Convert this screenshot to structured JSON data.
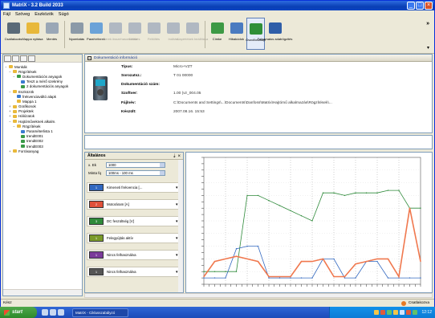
{
  "window": {
    "title": "MatriX - 3.2 Build 2033"
  },
  "menu": {
    "items": [
      "Fájl",
      "Szöveg",
      "Eszközök",
      "Súgó"
    ]
  },
  "toolbar": {
    "buttons": [
      {
        "label": "Csatlakozás",
        "icon": "plug-icon",
        "color": "#5a6a78"
      },
      {
        "label": "Mappa nyitása",
        "icon": "folder-icon",
        "color": "#e8b83a"
      },
      {
        "label": "Mentés",
        "icon": "save-icon",
        "color": "#9aa7b6"
      },
      {
        "label": "Nyomtatás",
        "icon": "print-icon",
        "color": "#8b9aa8"
      },
      {
        "label": "Paraméterek",
        "icon": "document-icon",
        "color": "#6aa2d8"
      },
      {
        "label": "Paraméterek összehasonlítása",
        "icon": "compare-icon",
        "color": "#b0b8c2"
      },
      {
        "label": "Letöltés",
        "icon": "download-icon",
        "color": "#b0b8c2"
      },
      {
        "label": "Feltöltés",
        "icon": "upload-icon",
        "color": "#b0b8c2"
      },
      {
        "label": "Indítás",
        "icon": "motor-icon",
        "color": "#b0b8c2"
      },
      {
        "label": "Alapértékek beállítása",
        "icon": "reset-icon",
        "color": "#b0b8c2"
      },
      {
        "label": "Címke",
        "icon": "tag-icon",
        "color": "#3d9a45"
      },
      {
        "label": "Hibakódok",
        "icon": "search-icon",
        "color": "#4a7bc0"
      },
      {
        "label": "Oszcilloszkóp",
        "icon": "scope-icon",
        "color": "#2f8f36"
      },
      {
        "label": "Folyamatos adatrögzítés",
        "icon": "chip-icon",
        "color": "#2f5ea8"
      }
    ],
    "more": "»",
    "pin": "▾"
  },
  "tree": {
    "items": [
      {
        "label": "Munkák",
        "level": 0,
        "exp": "−",
        "color": "#e9b93a"
      },
      {
        "label": "Rögzítések",
        "level": 1,
        "exp": "−",
        "color": "#e9b93a"
      },
      {
        "label": "Dokumentációs anyagok",
        "level": 2,
        "exp": "−",
        "color": "#3a9a48"
      },
      {
        "label": "Teszt a mérő szekrény",
        "level": 3,
        "exp": "",
        "color": "#3a7bd0"
      },
      {
        "label": "2 dokumentációs anyagok",
        "level": 3,
        "exp": "",
        "color": "#3a9a48"
      },
      {
        "label": "Eszközök",
        "level": 1,
        "exp": "−",
        "color": "#e9b93a"
      },
      {
        "label": "frekvenciaváltó alapk",
        "level": 2,
        "exp": "",
        "color": "#3a7bd0"
      },
      {
        "label": "Mappa 1",
        "level": 2,
        "exp": "",
        "color": "#e9b93a"
      },
      {
        "label": "Grafikonok",
        "level": 1,
        "exp": "+",
        "color": "#e9b93a"
      },
      {
        "label": "Projektek",
        "level": 1,
        "exp": "+",
        "color": "#e9b93a"
      },
      {
        "label": "Hálózatok",
        "level": 1,
        "exp": "+",
        "color": "#e9b93a"
      },
      {
        "label": "Hajtóműveknek alkalm.",
        "level": 1,
        "exp": "−",
        "color": "#e9b93a"
      },
      {
        "label": "Rögzítések",
        "level": 2,
        "exp": "−",
        "color": "#e9b93a"
      },
      {
        "label": "Paraméterlista 1",
        "level": 3,
        "exp": "",
        "color": "#3a7bd0"
      },
      {
        "label": "trendE001",
        "level": 3,
        "exp": "",
        "color": "#3a9a48"
      },
      {
        "label": "trendE002",
        "level": 3,
        "exp": "",
        "color": "#3a9a48"
      },
      {
        "label": "trendE003",
        "level": 3,
        "exp": "",
        "color": "#3a9a48"
      },
      {
        "label": "Forrásanyag",
        "level": 1,
        "exp": "+",
        "color": "#e9b93a"
      }
    ]
  },
  "info": {
    "header": "Dokumentáció információ",
    "rows": [
      {
        "key": "Típus:",
        "value": "Micro+VZT"
      },
      {
        "key": "Sorozatsz.:",
        "value": "T 01 00000"
      },
      {
        "key": "Dokumentáció szám:",
        "value": ""
      },
      {
        "key": "Szoftver:",
        "value": "1.00 (vz_004.05"
      },
      {
        "key": "Fájlnév:",
        "value": "C:\\Documents and Settings\\...\\Documents\\Danfoss\\Matrix\\Hajtómű alkalmazás\\Rögzítések\\..."
      },
      {
        "key": "Készült:",
        "value": "2007.08.16. 15:53"
      }
    ]
  },
  "signals": {
    "title": "Általános",
    "pin": "⇣ ×",
    "x_label": "x. Ek",
    "x_value": "1000",
    "y_label": "Minta fq",
    "y_value": "100ms - 100 ms",
    "items": [
      {
        "num": "1",
        "label": "Kimeneti frekvencia [...",
        "color": "#3268c0"
      },
      {
        "num": "2",
        "label": "Motoráram [A]",
        "color": "#e0503a"
      },
      {
        "num": "3",
        "label": "DC feszültség [V]",
        "color": "#2e8a3a"
      },
      {
        "num": "1",
        "label": "Felegyújtás aktív",
        "color": "#7a9a2a"
      },
      {
        "num": "1",
        "label": "Nincs felhasználva",
        "color": "#7a3a9a"
      },
      {
        "num": "1",
        "label": "Nincs felhasználva",
        "color": "#555555"
      }
    ]
  },
  "chart_data": {
    "type": "line",
    "title": "",
    "xlabel": "",
    "ylabel": "",
    "x": [
      0,
      5,
      10,
      15,
      20,
      25,
      30,
      35,
      40,
      45,
      50,
      55,
      60,
      65,
      70,
      75,
      80,
      85,
      90,
      95,
      100
    ],
    "series": [
      {
        "color": "#2e8a3a",
        "values": [
          10,
          10,
          10,
          10,
          70,
          70,
          66,
          62,
          58,
          54,
          50,
          72,
          72,
          70,
          72,
          72,
          72,
          74,
          74,
          60,
          60
        ]
      },
      {
        "color": "#3268c0",
        "values": [
          5,
          5,
          5,
          28,
          30,
          30,
          5,
          5,
          5,
          5,
          5,
          20,
          20,
          5,
          5,
          18,
          18,
          5,
          5,
          5,
          5
        ]
      },
      {
        "color": "#f0784e",
        "values": [
          6,
          18,
          20,
          22,
          20,
          18,
          6,
          6,
          6,
          18,
          18,
          20,
          6,
          6,
          16,
          18,
          20,
          20,
          6,
          60,
          18
        ]
      }
    ],
    "ylim": [
      0,
      100
    ]
  },
  "status": {
    "left": "Kész",
    "right": "Csatlakozva"
  },
  "taskbar": {
    "start": "start",
    "task": "MatriX - Ciklusszabályzó",
    "clock": "12:12"
  }
}
